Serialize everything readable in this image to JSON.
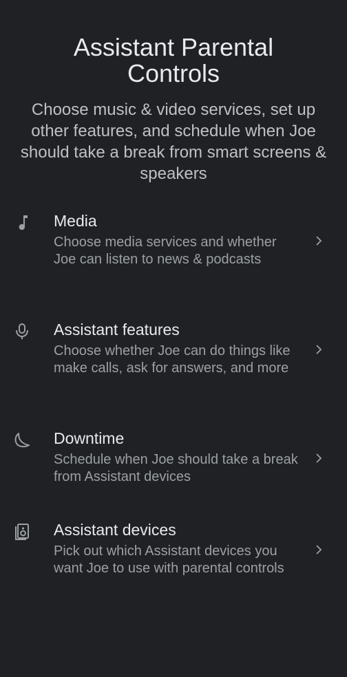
{
  "header": {
    "title": "Assistant Parental Controls",
    "subtitle": "Choose music & video services, set up other features, and schedule when Joe should take a break from smart screens & speakers"
  },
  "items": [
    {
      "icon": "music-note-icon",
      "label": "Media",
      "description": "Choose media services and whether Joe can listen to news & podcasts"
    },
    {
      "icon": "microphone-icon",
      "label": "Assistant features",
      "description": "Choose whether Joe can do things like make calls, ask for answers, and more"
    },
    {
      "icon": "moon-icon",
      "label": "Downtime",
      "description": "Schedule when Joe should take a break from Assistant devices"
    },
    {
      "icon": "speaker-icon",
      "label": "Assistant devices",
      "description": "Pick out which Assistant devices you want Joe to use with parental controls"
    }
  ],
  "colors": {
    "background": "#202124",
    "primary_text": "#e8eaed",
    "secondary_text": "#9aa0a6"
  }
}
